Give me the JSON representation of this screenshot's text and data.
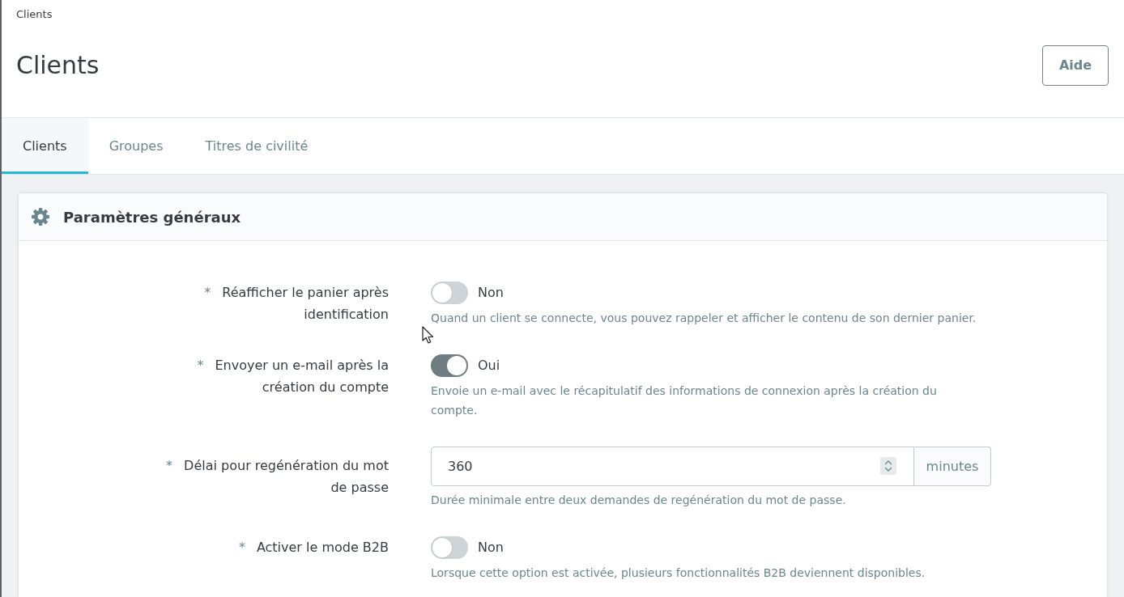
{
  "breadcrumb": [
    {
      "label": "Clients"
    }
  ],
  "page_title": "Clients",
  "header_buttons": [
    {
      "label": "Aide"
    }
  ],
  "tabs": [
    {
      "label": "Clients",
      "selected": true
    },
    {
      "label": "Groupes",
      "selected": false
    },
    {
      "label": "Titres de civilité",
      "selected": false
    }
  ],
  "panel": {
    "title": "Paramètres généraux",
    "fields": [
      {
        "kind": "switch",
        "required_marker": "*",
        "label": "Réafficher le panier après identification",
        "on": false,
        "state_label": "Non",
        "help": "Quand un client se connecte, vous pouvez rappeler et afficher le contenu de son dernier panier."
      },
      {
        "kind": "switch",
        "required_marker": "*",
        "label": "Envoyer un e-mail après la création du compte",
        "on": true,
        "state_label": "Oui",
        "help": "Envoie un e-mail avec le récapitulatif des informations de connexion après la création du compte."
      },
      {
        "kind": "number",
        "required_marker": "*",
        "label": "Délai pour regénération du mot de passe",
        "value": "360",
        "unit": "minutes",
        "help": "Durée minimale entre deux demandes de regénération du mot de passe."
      },
      {
        "kind": "switch",
        "required_marker": "*",
        "label": "Activer le mode B2B",
        "on": false,
        "state_label": "Non",
        "help": "Lorsque cette option est activée, plusieurs fonctionnalités B2B deviennent disponibles."
      }
    ]
  }
}
